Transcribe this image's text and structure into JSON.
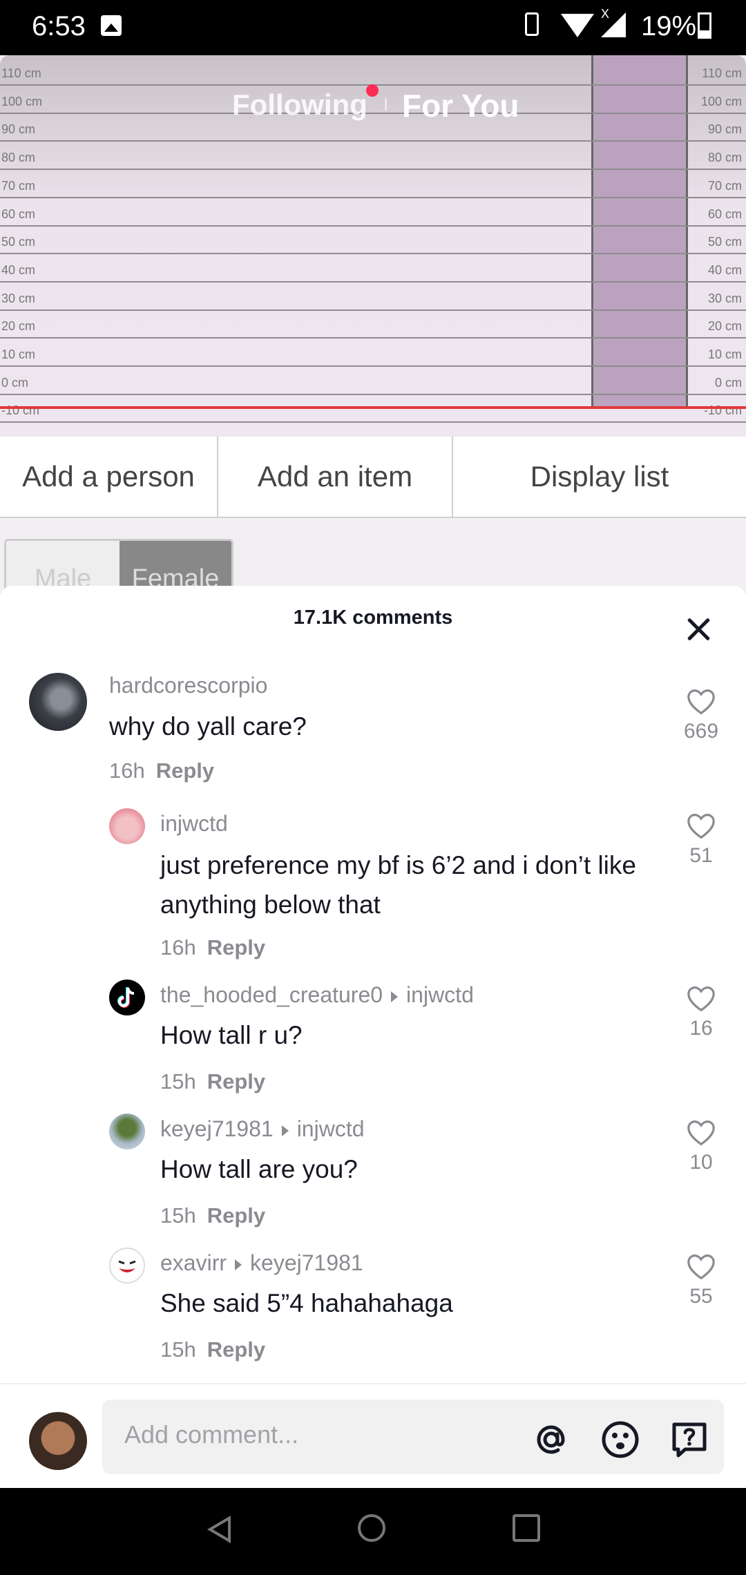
{
  "status_bar": {
    "time": "6:53",
    "battery": "19%",
    "signal_extra": "X"
  },
  "feed_tabs": {
    "following": "Following",
    "for_you": "For You"
  },
  "video": {
    "left_ticks": [
      "110 cm",
      "100 cm",
      "90 cm",
      "80 cm",
      "70 cm",
      "60 cm",
      "50 cm",
      "40 cm",
      "30 cm",
      "20 cm",
      "10 cm",
      "0 cm",
      "-10 cm"
    ],
    "right_ticks": [
      "110 cm",
      "100 cm",
      "90 cm",
      "80 cm",
      "70 cm",
      "60 cm",
      "50 cm",
      "40 cm",
      "30 cm",
      "20 cm",
      "10 cm",
      "0 cm",
      "-10 cm"
    ],
    "buttons": {
      "add_person": "Add a person",
      "add_item": "Add an item",
      "display_list": "Display list"
    },
    "gender": {
      "male": "Male",
      "female": "Female"
    }
  },
  "comments_sheet": {
    "title": "17.1K comments",
    "comments": [
      {
        "user": "hardcorescorpio",
        "reply_to": "",
        "text": "why do yall care?",
        "time": "16h",
        "reply": "Reply",
        "likes": "669"
      },
      {
        "user": "injwctd",
        "reply_to": "",
        "text": "just preference my bf is 6’2 and i don’t like anything below that",
        "time": "16h",
        "reply": "Reply",
        "likes": "51"
      },
      {
        "user": "the_hooded_creature0",
        "reply_to": "injwctd",
        "text": "How tall r u?",
        "time": "15h",
        "reply": "Reply",
        "likes": "16"
      },
      {
        "user": "keyej71981",
        "reply_to": "injwctd",
        "text": "How tall are you?",
        "time": "15h",
        "reply": "Reply",
        "likes": "10"
      },
      {
        "user": "exavirr",
        "reply_to": "keyej71981",
        "text": "She said 5”4 hahahahaga",
        "time": "15h",
        "reply": "Reply",
        "likes": "55"
      }
    ]
  },
  "comment_input": {
    "placeholder": "Add comment..."
  },
  "icons": {
    "mention": "at-sign-icon",
    "emoji": "emoji-icon",
    "question": "question-bubble-icon"
  },
  "colors": {
    "accent": "#fe2c55",
    "text": "#161823",
    "muted": "#8a8b91"
  }
}
